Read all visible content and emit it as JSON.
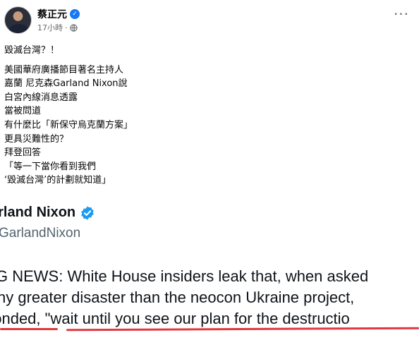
{
  "header": {
    "author": "蔡正元",
    "timestamp": "17小時",
    "separator": "·",
    "more_label": "···"
  },
  "post": {
    "lines": [
      "毀滅台灣？！",
      "美國華府廣播節目著名主持人",
      "嘉蘭 尼克森Garland Nixon說",
      "白宮內線消息透露",
      "當被問道",
      "有什麼比「新保守烏克蘭方案」",
      "更具災難性的？",
      "拜登回答",
      "「等一下當你看到我們",
      "‘毀滅台灣’的計劃就知道」"
    ]
  },
  "embed": {
    "name": "arland Nixon",
    "handle": "GarlandNixon",
    "lines": [
      "G NEWS: White House insiders leak that, when asked",
      "ny greater disaster than the neocon Ukraine project,",
      "ponded, \"wait until you see our plan for the destructio"
    ]
  },
  "colors": {
    "verified": "#1877f2",
    "twitter_verified": "#1d9bf0",
    "underline": "#e0383e",
    "secondary_text": "#65676b"
  }
}
